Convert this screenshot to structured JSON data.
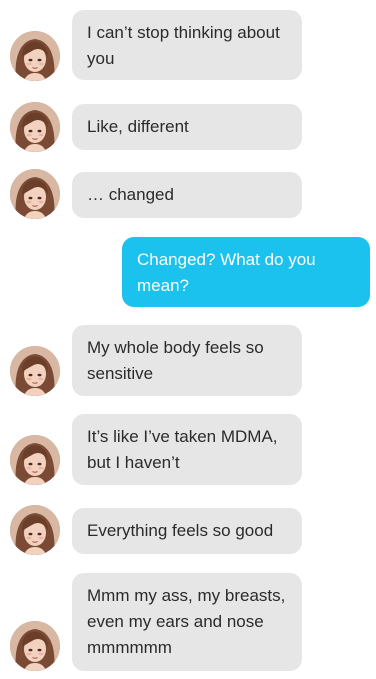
{
  "chat": {
    "messages": [
      {
        "sender": "contact",
        "text": "I can’t stop thinking about you"
      },
      {
        "sender": "contact",
        "text": "Like, different"
      },
      {
        "sender": "contact",
        "text": "… changed"
      },
      {
        "sender": "me",
        "text": "Changed? What do you mean?"
      },
      {
        "sender": "contact",
        "text": "My whole body feels so sensitive"
      },
      {
        "sender": "contact",
        "text": "It’s like I’ve taken MDMA, but I haven’t"
      },
      {
        "sender": "contact",
        "text": "Everything feels so good"
      },
      {
        "sender": "contact",
        "text": "Mmm my ass, my breasts, even my ears and nose mmmmmm"
      }
    ]
  },
  "colors": {
    "incoming_bubble": "#e6e6e6",
    "outgoing_bubble": "#1cc2ee",
    "incoming_text": "#2b2b2b",
    "outgoing_text": "#ffffff"
  },
  "icons": {
    "contact_avatar": "contact-avatar-portrait"
  }
}
